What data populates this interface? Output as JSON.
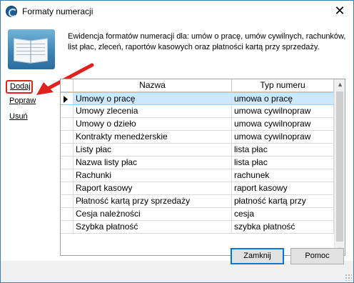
{
  "window": {
    "title": "Formaty numeracji",
    "close_glyph": "✕",
    "icon": "app-logo-icon"
  },
  "description": "Ewidencja formatów numeracji dla: umów o pracę, umów cywilnych, rachunków, list płac, zleceń, raportów kasowych oraz płatności kartą przy sprzedaży.",
  "illustration_icon": "book-icon",
  "actions": {
    "add": "Dodaj",
    "edit": "Popraw",
    "delete": "Usuń"
  },
  "annotation": {
    "arrow_color": "#e0221f",
    "highlight_color": "#e0221f"
  },
  "grid": {
    "columns": [
      "Nazwa",
      "Typ numeru"
    ],
    "selected_row_index": 0,
    "rows": [
      {
        "name": "Umowy o pracę",
        "type": "umowa o pracę"
      },
      {
        "name": "Umowy zlecenia",
        "type": "umowa cywilnopraw"
      },
      {
        "name": "Umowy o dzieło",
        "type": "umowa cywilnopraw"
      },
      {
        "name": "Kontrakty menedżerskie",
        "type": "umowa cywilnopraw"
      },
      {
        "name": "Listy płac",
        "type": "lista płac"
      },
      {
        "name": "Nazwa listy płac",
        "type": "lista płac"
      },
      {
        "name": "Rachunki",
        "type": "rachunek"
      },
      {
        "name": "Raport kasowy",
        "type": "raport kasowy"
      },
      {
        "name": "Płatność kartą przy sprzedaży",
        "type": "płatność kartą przy"
      },
      {
        "name": "Cesja należności",
        "type": "cesja"
      },
      {
        "name": "Szybka płatność",
        "type": "szybka płatność"
      }
    ]
  },
  "buttons": {
    "close": "Zamknij",
    "help": "Pomoc"
  }
}
